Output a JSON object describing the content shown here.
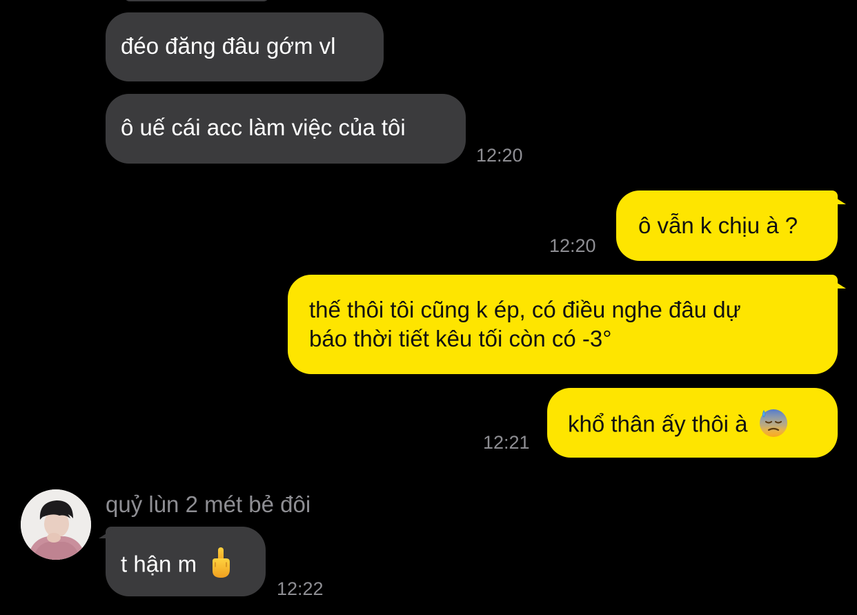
{
  "colors": {
    "background": "#000000",
    "incoming_bubble": "#3b3b3d",
    "outgoing_bubble": "#fee500",
    "timestamp": "#8e8e93"
  },
  "messages": [
    {
      "direction": "incoming",
      "text": "đéo đăng đâu gớm vl",
      "time": ""
    },
    {
      "direction": "incoming",
      "text": "ô uế cái acc làm việc của tôi",
      "time": "12:20"
    },
    {
      "direction": "outgoing",
      "text": "ô vẫn k chịu à ?",
      "time": "12:20"
    },
    {
      "direction": "outgoing",
      "lines": [
        "thế thôi tôi cũng k ép, có điều nghe đâu dự",
        "báo thời tiết kêu tối còn có -3°"
      ],
      "time": ""
    },
    {
      "direction": "outgoing",
      "text": "khổ thân ấy thôi à",
      "emoji": "downcast-face-with-sweat-emoji",
      "time": "12:21"
    },
    {
      "direction": "incoming",
      "sender": "quỷ lùn 2 mét bẻ đôi",
      "text": "t hận m",
      "emoji": "middle-finger-emoji",
      "time": "12:22"
    }
  ]
}
